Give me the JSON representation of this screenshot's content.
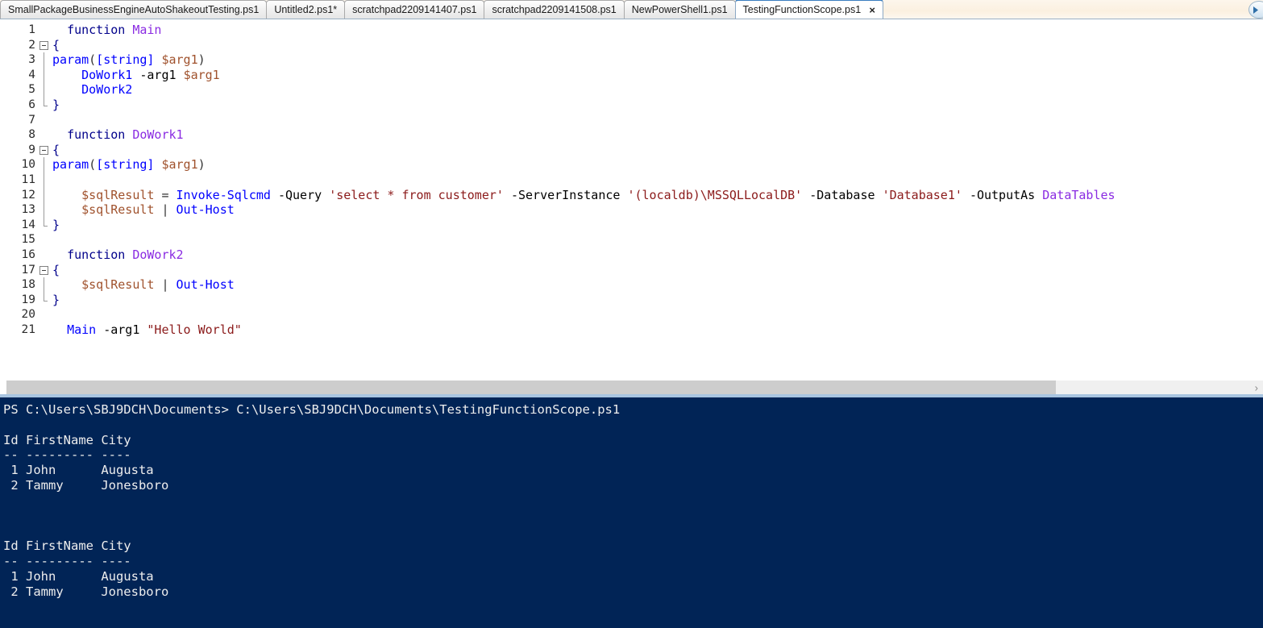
{
  "app": {
    "name": "Windows PowerShell ISE"
  },
  "tabbar": {
    "scroll_icon": "scroll-right-icon",
    "tabs": [
      {
        "label": "SmallPackageBusinessEngineAutoShakeoutTesting.ps1",
        "active": false,
        "modified": false
      },
      {
        "label": "Untitled2.ps1*",
        "active": false,
        "modified": true
      },
      {
        "label": "scratchpad2209141407.ps1",
        "active": false,
        "modified": false
      },
      {
        "label": "scratchpad2209141508.ps1",
        "active": false,
        "modified": false
      },
      {
        "label": "NewPowerShell1.ps1",
        "active": false,
        "modified": false
      },
      {
        "label": "TestingFunctionScope.ps1",
        "active": true,
        "modified": false,
        "close_glyph": "×"
      }
    ]
  },
  "editor": {
    "filename": "TestingFunctionScope.ps1",
    "language": "PowerShell",
    "first_line": 1,
    "last_line": 21,
    "lines": [
      {
        "n": "1",
        "fold": "none",
        "tokens": [
          {
            "t": "  ",
            "c": "t-plain"
          },
          {
            "t": "function",
            "c": "t-kw"
          },
          {
            "t": " ",
            "c": "t-plain"
          },
          {
            "t": "Main",
            "c": "t-fn"
          }
        ]
      },
      {
        "n": "2",
        "fold": "start",
        "tokens": [
          {
            "t": "{",
            "c": "t-brace"
          }
        ]
      },
      {
        "n": "3",
        "fold": "mid",
        "tokens": [
          {
            "t": "param",
            "c": "t-cmd"
          },
          {
            "t": "(",
            "c": "t-op"
          },
          {
            "t": "[string]",
            "c": "t-type"
          },
          {
            "t": " ",
            "c": "t-plain"
          },
          {
            "t": "$arg1",
            "c": "t-var"
          },
          {
            "t": ")",
            "c": "t-op"
          }
        ]
      },
      {
        "n": "4",
        "fold": "mid",
        "tokens": [
          {
            "t": "    ",
            "c": "t-plain"
          },
          {
            "t": "DoWork1",
            "c": "t-cmd"
          },
          {
            "t": " ",
            "c": "t-plain"
          },
          {
            "t": "-arg1",
            "c": "t-plain"
          },
          {
            "t": " ",
            "c": "t-plain"
          },
          {
            "t": "$arg1",
            "c": "t-var"
          }
        ]
      },
      {
        "n": "5",
        "fold": "mid",
        "tokens": [
          {
            "t": "    ",
            "c": "t-plain"
          },
          {
            "t": "DoWork2",
            "c": "t-cmd"
          }
        ]
      },
      {
        "n": "6",
        "fold": "end",
        "tokens": [
          {
            "t": "}",
            "c": "t-brace"
          }
        ]
      },
      {
        "n": "7",
        "fold": "none",
        "tokens": []
      },
      {
        "n": "8",
        "fold": "none",
        "tokens": [
          {
            "t": "  ",
            "c": "t-plain"
          },
          {
            "t": "function",
            "c": "t-kw"
          },
          {
            "t": " ",
            "c": "t-plain"
          },
          {
            "t": "DoWork1",
            "c": "t-fn"
          }
        ]
      },
      {
        "n": "9",
        "fold": "start",
        "tokens": [
          {
            "t": "{",
            "c": "t-brace"
          }
        ]
      },
      {
        "n": "10",
        "fold": "mid",
        "tokens": [
          {
            "t": "param",
            "c": "t-cmd"
          },
          {
            "t": "(",
            "c": "t-op"
          },
          {
            "t": "[string]",
            "c": "t-type"
          },
          {
            "t": " ",
            "c": "t-plain"
          },
          {
            "t": "$arg1",
            "c": "t-var"
          },
          {
            "t": ")",
            "c": "t-op"
          }
        ]
      },
      {
        "n": "11",
        "fold": "mid",
        "tokens": []
      },
      {
        "n": "12",
        "fold": "mid",
        "tokens": [
          {
            "t": "    ",
            "c": "t-plain"
          },
          {
            "t": "$sqlResult",
            "c": "t-var"
          },
          {
            "t": " ",
            "c": "t-plain"
          },
          {
            "t": "=",
            "c": "t-op"
          },
          {
            "t": " ",
            "c": "t-plain"
          },
          {
            "t": "Invoke-Sqlcmd",
            "c": "t-cmd"
          },
          {
            "t": " ",
            "c": "t-plain"
          },
          {
            "t": "-Query",
            "c": "t-plain"
          },
          {
            "t": " ",
            "c": "t-plain"
          },
          {
            "t": "'select * from customer'",
            "c": "t-str"
          },
          {
            "t": " ",
            "c": "t-plain"
          },
          {
            "t": "-ServerInstance",
            "c": "t-plain"
          },
          {
            "t": " ",
            "c": "t-plain"
          },
          {
            "t": "'(localdb)\\MSSQLLocalDB'",
            "c": "t-str"
          },
          {
            "t": " ",
            "c": "t-plain"
          },
          {
            "t": "-Database",
            "c": "t-plain"
          },
          {
            "t": " ",
            "c": "t-plain"
          },
          {
            "t": "'Database1'",
            "c": "t-str"
          },
          {
            "t": " ",
            "c": "t-plain"
          },
          {
            "t": "-OutputAs",
            "c": "t-plain"
          },
          {
            "t": " ",
            "c": "t-plain"
          },
          {
            "t": "DataTables",
            "c": "t-fn"
          }
        ]
      },
      {
        "n": "13",
        "fold": "mid",
        "tokens": [
          {
            "t": "    ",
            "c": "t-plain"
          },
          {
            "t": "$sqlResult",
            "c": "t-var"
          },
          {
            "t": " ",
            "c": "t-plain"
          },
          {
            "t": "|",
            "c": "t-op"
          },
          {
            "t": " ",
            "c": "t-plain"
          },
          {
            "t": "Out-Host",
            "c": "t-cmd"
          }
        ]
      },
      {
        "n": "14",
        "fold": "end",
        "tokens": [
          {
            "t": "}",
            "c": "t-brace"
          }
        ]
      },
      {
        "n": "15",
        "fold": "none",
        "tokens": []
      },
      {
        "n": "16",
        "fold": "none",
        "tokens": [
          {
            "t": "  ",
            "c": "t-plain"
          },
          {
            "t": "function",
            "c": "t-kw"
          },
          {
            "t": " ",
            "c": "t-plain"
          },
          {
            "t": "DoWork2",
            "c": "t-fn"
          }
        ]
      },
      {
        "n": "17",
        "fold": "start",
        "tokens": [
          {
            "t": "{",
            "c": "t-brace"
          }
        ]
      },
      {
        "n": "18",
        "fold": "mid",
        "tokens": [
          {
            "t": "    ",
            "c": "t-plain"
          },
          {
            "t": "$sqlResult",
            "c": "t-var"
          },
          {
            "t": " ",
            "c": "t-plain"
          },
          {
            "t": "|",
            "c": "t-op"
          },
          {
            "t": " ",
            "c": "t-plain"
          },
          {
            "t": "Out-Host",
            "c": "t-cmd"
          }
        ]
      },
      {
        "n": "19",
        "fold": "end",
        "tokens": [
          {
            "t": "}",
            "c": "t-brace"
          }
        ]
      },
      {
        "n": "20",
        "fold": "none",
        "tokens": []
      },
      {
        "n": "21",
        "fold": "none",
        "tokens": [
          {
            "t": "  ",
            "c": "t-plain"
          },
          {
            "t": "Main",
            "c": "t-cmd"
          },
          {
            "t": " ",
            "c": "t-plain"
          },
          {
            "t": "-arg1",
            "c": "t-plain"
          },
          {
            "t": " ",
            "c": "t-plain"
          },
          {
            "t": "\"Hello World\"",
            "c": "t-str"
          }
        ]
      }
    ]
  },
  "scrollbar": {
    "orientation": "horizontal",
    "arrow_glyph": "›"
  },
  "console": {
    "prompt": "PS C:\\Users\\SBJ9DCH\\Documents> C:\\Users\\SBJ9DCH\\Documents\\TestingFunctionScope.ps1",
    "lines": [
      "PS C:\\Users\\SBJ9DCH\\Documents> C:\\Users\\SBJ9DCH\\Documents\\TestingFunctionScope.ps1",
      "",
      "Id FirstName City",
      "-- --------- ----",
      " 1 John      Augusta",
      " 2 Tammy     Jonesboro",
      "",
      "",
      "",
      "Id FirstName City",
      "-- --------- ----",
      " 1 John      Augusta",
      " 2 Tammy     Jonesboro"
    ],
    "result_tables": [
      {
        "headers": [
          "Id",
          "FirstName",
          "City"
        ],
        "rows": [
          [
            "1",
            "John",
            "Augusta"
          ],
          [
            "2",
            "Tammy",
            "Jonesboro"
          ]
        ]
      },
      {
        "headers": [
          "Id",
          "FirstName",
          "City"
        ],
        "rows": [
          [
            "1",
            "John",
            "Augusta"
          ],
          [
            "2",
            "Tammy",
            "Jonesboro"
          ]
        ]
      }
    ]
  },
  "colors": {
    "console_bg": "#012456",
    "console_fg": "#eeeeee",
    "editor_bg": "#ffffff",
    "tabbar_bg": "#fbf0e0",
    "active_tab_accent": "#3a7ebf",
    "splitter": "#a8c4e0",
    "keyword": "#00008b",
    "function_name": "#8a2be2",
    "cmdlet": "#0000ff",
    "variable": "#a0522d",
    "string": "#8b1a1a"
  }
}
